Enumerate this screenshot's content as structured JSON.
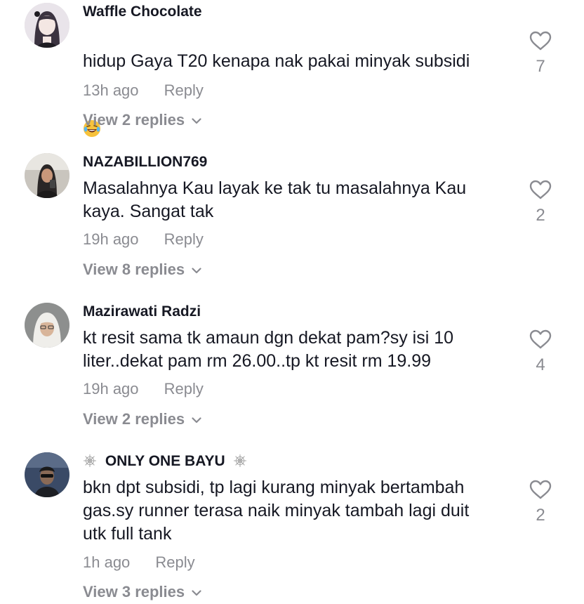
{
  "comments": [
    {
      "username": "Waffle Chocolate",
      "text": "hidup Gaya T20 kenapa nak pakai minyak subsidi",
      "emoji": "laughing-emoji",
      "time": "13h ago",
      "reply_label": "Reply",
      "view_replies": "View 2 replies",
      "likes": "7"
    },
    {
      "username": "NAZABILLION769",
      "text": "Masalahnya Kau layak ke tak tu masalahnya Kau\nkaya. Sangat tak",
      "time": "19h ago",
      "reply_label": "Reply",
      "view_replies": "View 8 replies",
      "likes": "2"
    },
    {
      "username": "Mazirawati Radzi",
      "text": "kt resit sama tk amaun dgn dekat pam?sy isi 10\nliter..dekat pam rm 26.00..tp kt resit rm 19.99",
      "time": "19h ago",
      "reply_label": "Reply",
      "view_replies": "View 2 replies",
      "likes": "4"
    },
    {
      "username": "ONLY ONE BAYU",
      "username_decoration": "spider-web-icon",
      "text": "bkn dpt subsidi, tp lagi kurang minyak bertambah\ngas.sy runner terasa naik minyak tambah lagi duit\nutk full tank",
      "time": "1h ago",
      "reply_label": "Reply",
      "view_replies": "View 3 replies",
      "likes": "2"
    }
  ],
  "colors": {
    "text": "#161823",
    "secondary": "#8a8b91",
    "background": "#ffffff"
  }
}
